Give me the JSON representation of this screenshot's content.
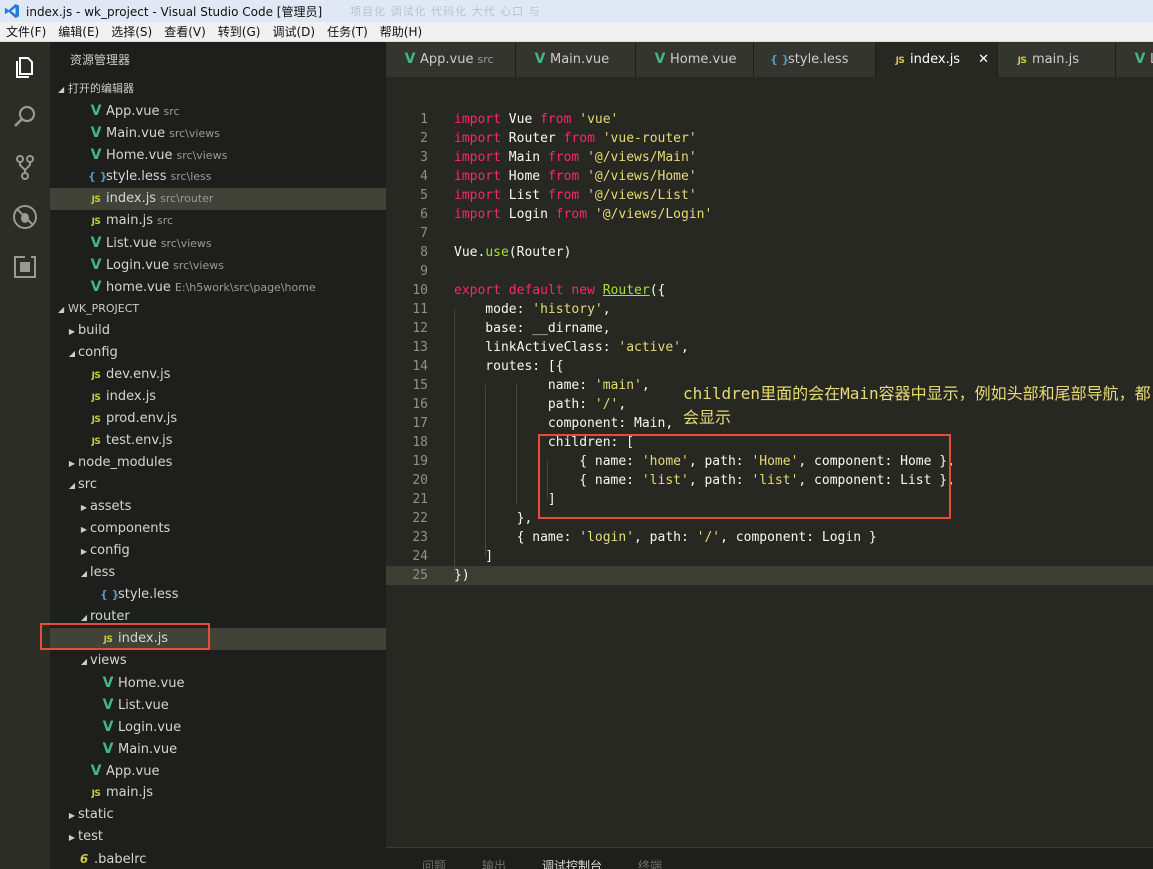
{
  "window": {
    "title": "index.js - wk_project - Visual Studio Code [管理员]",
    "ghost_text": "项目化  调试化  代码化  大代  心口 与"
  },
  "menu": [
    "文件(F)",
    "编辑(E)",
    "选择(S)",
    "查看(V)",
    "转到(G)",
    "调试(D)",
    "任务(T)",
    "帮助(H)"
  ],
  "sidebar": {
    "title": "资源管理器",
    "open_editors_header": "打开的编辑器",
    "open_editors": [
      {
        "type": "vue",
        "name": "App.vue",
        "desc": "src"
      },
      {
        "type": "vue",
        "name": "Main.vue",
        "desc": "src\\views"
      },
      {
        "type": "vue",
        "name": "Home.vue",
        "desc": "src\\views"
      },
      {
        "type": "less",
        "name": "style.less",
        "desc": "src\\less"
      },
      {
        "type": "js",
        "name": "index.js",
        "desc": "src\\router"
      },
      {
        "type": "js",
        "name": "main.js",
        "desc": "src"
      },
      {
        "type": "vue",
        "name": "List.vue",
        "desc": "src\\views"
      },
      {
        "type": "vue",
        "name": "Login.vue",
        "desc": "src\\views"
      },
      {
        "type": "vue",
        "name": "home.vue",
        "desc": "E:\\h5work\\src\\page\\home"
      }
    ],
    "project_header": "WK_PROJECT",
    "tree": [
      {
        "kind": "folder",
        "open": false,
        "name": "build",
        "depth": 0
      },
      {
        "kind": "folder",
        "open": true,
        "name": "config",
        "depth": 0
      },
      {
        "kind": "file",
        "type": "js",
        "name": "dev.env.js",
        "depth": 1
      },
      {
        "kind": "file",
        "type": "js",
        "name": "index.js",
        "depth": 1
      },
      {
        "kind": "file",
        "type": "js",
        "name": "prod.env.js",
        "depth": 1
      },
      {
        "kind": "file",
        "type": "js",
        "name": "test.env.js",
        "depth": 1
      },
      {
        "kind": "folder",
        "open": false,
        "name": "node_modules",
        "depth": 0
      },
      {
        "kind": "folder",
        "open": true,
        "name": "src",
        "depth": 0
      },
      {
        "kind": "folder",
        "open": false,
        "name": "assets",
        "depth": 1
      },
      {
        "kind": "folder",
        "open": false,
        "name": "components",
        "depth": 1
      },
      {
        "kind": "folder",
        "open": false,
        "name": "config",
        "depth": 1
      },
      {
        "kind": "folder",
        "open": true,
        "name": "less",
        "depth": 1
      },
      {
        "kind": "file",
        "type": "less",
        "name": "style.less",
        "depth": 2
      },
      {
        "kind": "folder",
        "open": true,
        "name": "router",
        "depth": 1
      },
      {
        "kind": "file",
        "type": "js",
        "name": "index.js",
        "depth": 2,
        "selected": true
      },
      {
        "kind": "folder",
        "open": true,
        "name": "views",
        "depth": 1
      },
      {
        "kind": "file",
        "type": "vue",
        "name": "Home.vue",
        "depth": 2
      },
      {
        "kind": "file",
        "type": "vue",
        "name": "List.vue",
        "depth": 2
      },
      {
        "kind": "file",
        "type": "vue",
        "name": "Login.vue",
        "depth": 2
      },
      {
        "kind": "file",
        "type": "vue",
        "name": "Main.vue",
        "depth": 2
      },
      {
        "kind": "file",
        "type": "vue",
        "name": "App.vue",
        "depth": 1
      },
      {
        "kind": "file",
        "type": "js",
        "name": "main.js",
        "depth": 1
      },
      {
        "kind": "folder",
        "open": false,
        "name": "static",
        "depth": 0
      },
      {
        "kind": "folder",
        "open": false,
        "name": "test",
        "depth": 0
      },
      {
        "kind": "file",
        "type": "babel",
        "name": ".babelrc",
        "depth": 0
      }
    ]
  },
  "tabs": [
    {
      "type": "vue",
      "name": "App.vue",
      "desc": "src",
      "w": 130
    },
    {
      "type": "vue",
      "name": "Main.vue",
      "desc": "",
      "w": 120
    },
    {
      "type": "vue",
      "name": "Home.vue",
      "desc": "",
      "w": 118
    },
    {
      "type": "less",
      "name": "style.less",
      "desc": "",
      "w": 122
    },
    {
      "type": "js",
      "name": "index.js",
      "desc": "",
      "w": 122,
      "active": true,
      "close": "✕"
    },
    {
      "type": "js",
      "name": "main.js",
      "desc": "",
      "w": 118
    },
    {
      "type": "vue",
      "name": "L",
      "desc": "",
      "w": 40
    }
  ],
  "code_lines": [
    [
      [
        "kw",
        "import"
      ],
      [
        "t",
        " Vue "
      ],
      [
        "kw",
        "from"
      ],
      [
        "t",
        " "
      ],
      [
        "str",
        "'vue'"
      ]
    ],
    [
      [
        "kw",
        "import"
      ],
      [
        "t",
        " Router "
      ],
      [
        "kw",
        "from"
      ],
      [
        "t",
        " "
      ],
      [
        "str",
        "'vue-router'"
      ]
    ],
    [
      [
        "kw",
        "import"
      ],
      [
        "t",
        " Main "
      ],
      [
        "kw",
        "from"
      ],
      [
        "t",
        " "
      ],
      [
        "str",
        "'@/views/Main'"
      ]
    ],
    [
      [
        "kw",
        "import"
      ],
      [
        "t",
        " Home "
      ],
      [
        "kw",
        "from"
      ],
      [
        "t",
        " "
      ],
      [
        "str",
        "'@/views/Home'"
      ]
    ],
    [
      [
        "kw",
        "import"
      ],
      [
        "t",
        " List "
      ],
      [
        "kw",
        "from"
      ],
      [
        "t",
        " "
      ],
      [
        "str",
        "'@/views/List'"
      ]
    ],
    [
      [
        "kw",
        "import"
      ],
      [
        "t",
        " Login "
      ],
      [
        "kw",
        "from"
      ],
      [
        "t",
        " "
      ],
      [
        "str",
        "'@/views/Login'"
      ]
    ],
    [],
    [
      [
        "t",
        "Vue."
      ],
      [
        "fn",
        "use"
      ],
      [
        "t",
        "(Router)"
      ]
    ],
    [],
    [
      [
        "kw",
        "export"
      ],
      [
        "t",
        " "
      ],
      [
        "kw",
        "default"
      ],
      [
        "t",
        " "
      ],
      [
        "kw",
        "new"
      ],
      [
        "t",
        " "
      ],
      [
        "cls",
        "Router"
      ],
      [
        "t",
        "({"
      ]
    ],
    [
      [
        "t",
        "    mode: "
      ],
      [
        "str",
        "'history'"
      ],
      [
        "t",
        ","
      ]
    ],
    [
      [
        "t",
        "    base: __dirname,"
      ]
    ],
    [
      [
        "t",
        "    linkActiveClass: "
      ],
      [
        "str",
        "'active'"
      ],
      [
        "t",
        ","
      ]
    ],
    [
      [
        "t",
        "    routes: [{"
      ]
    ],
    [
      [
        "t",
        "            name: "
      ],
      [
        "str",
        "'main'"
      ],
      [
        "t",
        ","
      ]
    ],
    [
      [
        "t",
        "            path: "
      ],
      [
        "str",
        "'/'"
      ],
      [
        "t",
        ","
      ]
    ],
    [
      [
        "t",
        "            component: Main,"
      ]
    ],
    [
      [
        "t",
        "            children: ["
      ]
    ],
    [
      [
        "t",
        "                { name: "
      ],
      [
        "str",
        "'home'"
      ],
      [
        "t",
        ", path: "
      ],
      [
        "str",
        "'Home'"
      ],
      [
        "t",
        ", component: Home },"
      ]
    ],
    [
      [
        "t",
        "                { name: "
      ],
      [
        "str",
        "'list'"
      ],
      [
        "t",
        ", path: "
      ],
      [
        "str",
        "'list'"
      ],
      [
        "t",
        ", component: List },"
      ]
    ],
    [
      [
        "t",
        "            ]"
      ]
    ],
    [
      [
        "t",
        "        },"
      ]
    ],
    [
      [
        "t",
        "        { name: "
      ],
      [
        "str",
        "'login'"
      ],
      [
        "t",
        ", path: "
      ],
      [
        "str",
        "'/'"
      ],
      [
        "t",
        ", component: Login }"
      ]
    ],
    [
      [
        "t",
        "    ]"
      ]
    ],
    [
      [
        "t",
        "})"
      ]
    ]
  ],
  "annotation": "children里面的会在Main容器中显示，例如头部和尾部导航，都会显示",
  "panel_tabs": [
    "问题",
    "输出",
    "调试控制台",
    "终端"
  ]
}
